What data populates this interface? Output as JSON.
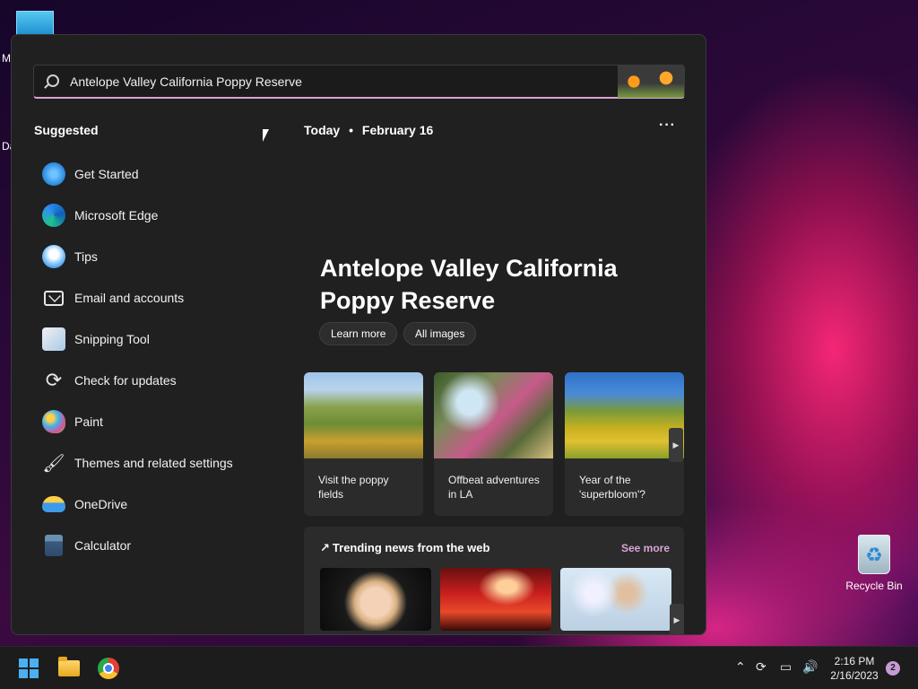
{
  "desktop": {
    "fragment_m": "M",
    "fragment_da": "Da",
    "recycle_bin_label": "Recycle Bin"
  },
  "search": {
    "query": "Antelope Valley California Poppy Reserve"
  },
  "suggested": {
    "title": "Suggested",
    "items": [
      {
        "label": "Get Started",
        "icon": "get-started-icon"
      },
      {
        "label": "Microsoft Edge",
        "icon": "edge-icon"
      },
      {
        "label": "Tips",
        "icon": "tips-icon"
      },
      {
        "label": "Email and accounts",
        "icon": "mail-icon"
      },
      {
        "label": "Snipping Tool",
        "icon": "snipping-tool-icon"
      },
      {
        "label": "Check for updates",
        "icon": "refresh-icon"
      },
      {
        "label": "Paint",
        "icon": "paint-icon"
      },
      {
        "label": "Themes and related settings",
        "icon": "brush-icon"
      },
      {
        "label": "OneDrive",
        "icon": "onedrive-icon"
      },
      {
        "label": "Calculator",
        "icon": "calculator-icon"
      }
    ]
  },
  "today": {
    "label": "Today",
    "separator": "•",
    "date": "February 16",
    "more": "···"
  },
  "hero": {
    "title": "Antelope Valley California Poppy Reserve",
    "learn_more": "Learn more",
    "all_images": "All images"
  },
  "cards": [
    {
      "caption": "Visit the poppy fields"
    },
    {
      "caption": "Offbeat adventures in LA"
    },
    {
      "caption": "Year of the 'superbloom'?"
    }
  ],
  "trending": {
    "title": "Trending news from the web",
    "see_more": "See more"
  },
  "taskbar": {
    "time": "2:16 PM",
    "date": "2/16/2023",
    "notification_count": "2"
  },
  "colors": {
    "accent": "#d7a6d6",
    "panel_bg": "#202020",
    "card_bg": "#2b2b2b"
  }
}
